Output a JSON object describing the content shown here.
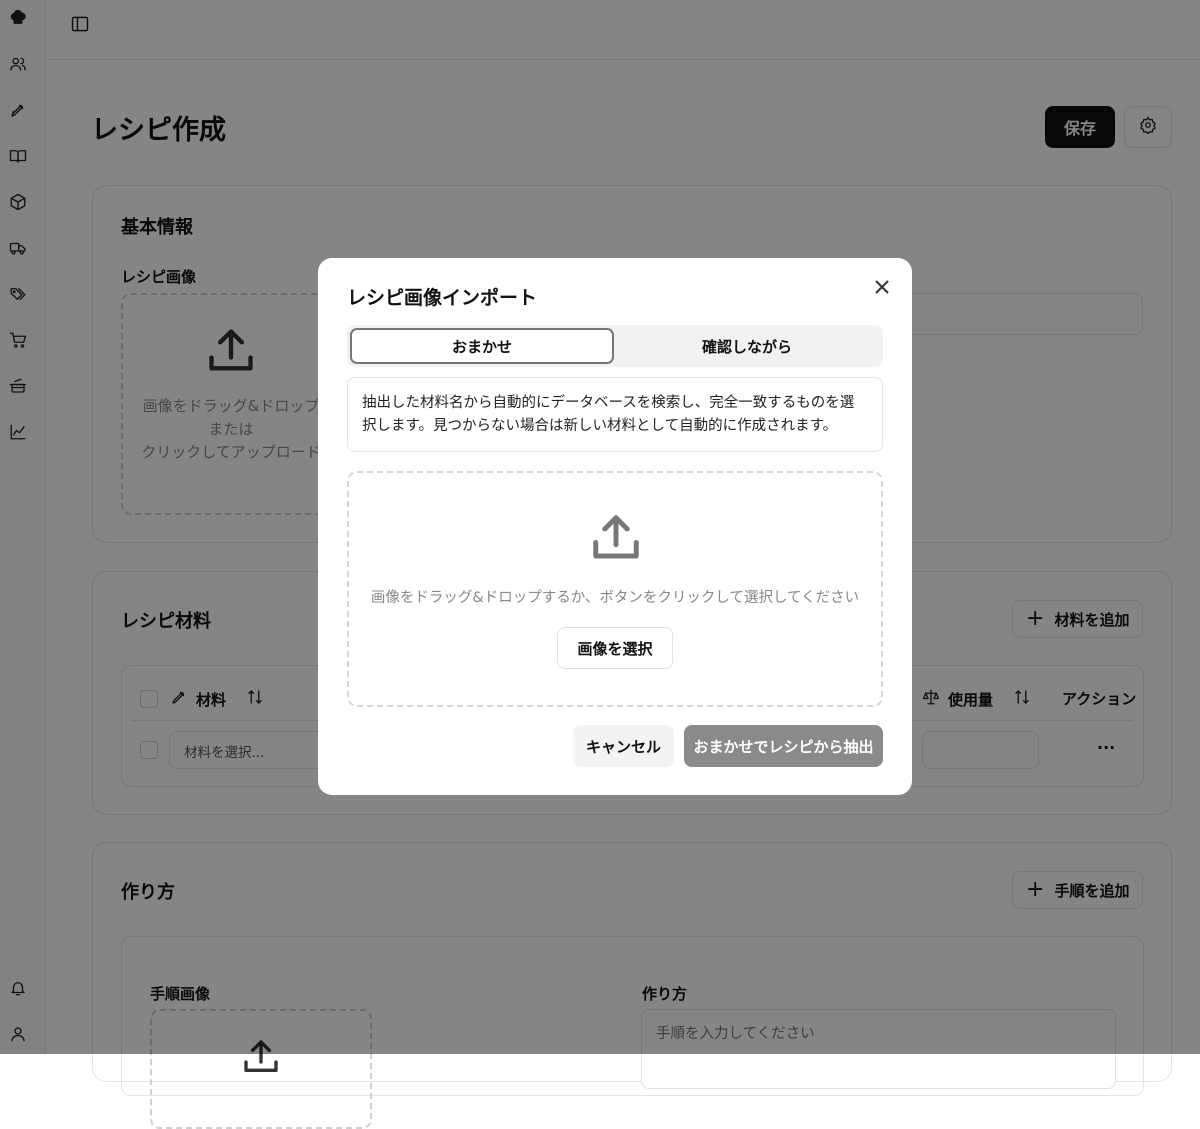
{
  "page": {
    "title": "レシピ作成",
    "save_label": "保存"
  },
  "sidebar": {
    "icons": [
      "chef-hat-icon",
      "users-icon",
      "pen-icon",
      "book-icon",
      "box-icon",
      "truck-icon",
      "tags-icon",
      "cart-icon",
      "pot-icon",
      "chart-icon",
      "bell-icon",
      "user-icon"
    ]
  },
  "basic_info": {
    "title": "基本情報",
    "image_label": "レシピ画像",
    "dropzone_line1": "画像をドラッグ&ドロップ",
    "dropzone_line2": "または",
    "dropzone_line3": "クリックしてアップロード"
  },
  "ingredients": {
    "title": "レシピ材料",
    "add_label": "材料を追加",
    "columns": {
      "material": "材料",
      "amount": "使用量",
      "action": "アクション"
    },
    "row_placeholder": "材料を選択...",
    "row_action": "···"
  },
  "steps": {
    "title": "作り方",
    "add_label": "手順を追加",
    "image_label": "手順画像",
    "method_label": "作り方",
    "method_placeholder": "手順を入力してください"
  },
  "modal": {
    "title": "レシピ画像インポート",
    "tabs": [
      {
        "label": "おまかせ",
        "active": true
      },
      {
        "label": "確認しながら",
        "active": false
      }
    ],
    "description": "抽出した材料名から自動的にデータベースを検索し、完全一致するものを選択します。見つからない場合は新しい材料として自動的に作成されます。",
    "dropzone_text": "画像をドラッグ&ドロップするか、ボタンをクリックして選択してください",
    "select_label": "画像を選択",
    "cancel_label": "キャンセル",
    "extract_label": "おまかせでレシピから抽出"
  }
}
